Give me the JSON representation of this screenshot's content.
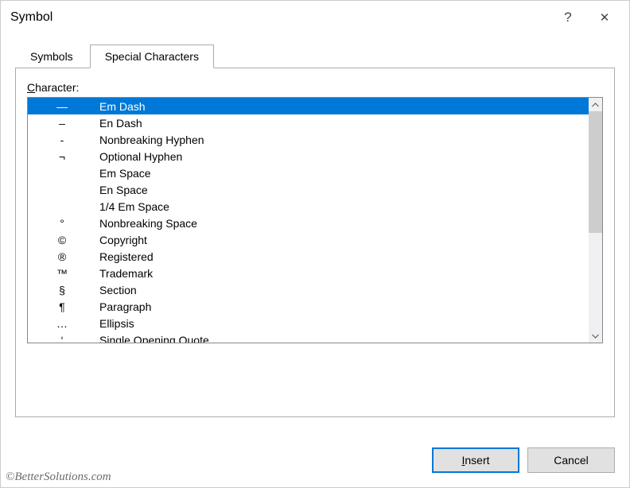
{
  "title": "Symbol",
  "help_glyph": "?",
  "close_glyph": "✕",
  "tabs": {
    "symbols": "Symbols",
    "special": "Special Characters"
  },
  "field_label_prefix": "C",
  "field_label_rest": "haracter:",
  "rows": [
    {
      "sym": "—",
      "name": "Em Dash",
      "selected": true
    },
    {
      "sym": "–",
      "name": "En Dash"
    },
    {
      "sym": "-",
      "name": "Nonbreaking Hyphen"
    },
    {
      "sym": "¬",
      "name": "Optional Hyphen"
    },
    {
      "sym": "",
      "name": "Em Space"
    },
    {
      "sym": "",
      "name": "En Space"
    },
    {
      "sym": "",
      "name": "1/4 Em Space"
    },
    {
      "sym": "°",
      "name": "Nonbreaking Space"
    },
    {
      "sym": "©",
      "name": "Copyright"
    },
    {
      "sym": "®",
      "name": "Registered"
    },
    {
      "sym": "™",
      "name": "Trademark"
    },
    {
      "sym": "§",
      "name": "Section"
    },
    {
      "sym": "¶",
      "name": "Paragraph"
    },
    {
      "sym": "…",
      "name": "Ellipsis"
    },
    {
      "sym": "‘",
      "name": "Single Opening Quote"
    }
  ],
  "buttons": {
    "insert_ul": "I",
    "insert_rest": "nsert",
    "cancel": "Cancel"
  },
  "watermark": "©BetterSolutions.com"
}
